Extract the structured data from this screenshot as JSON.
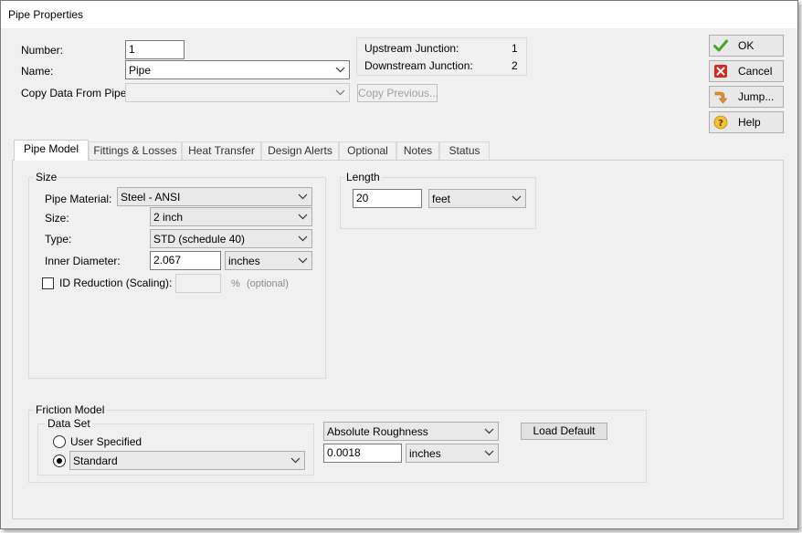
{
  "window": {
    "title": "Pipe Properties"
  },
  "header": {
    "number_label": "Number:",
    "number_value": "1",
    "name_label": "Name:",
    "name_value": "Pipe",
    "copy_label": "Copy Data From Pipe...",
    "copy_value": "",
    "copy_previous_label": "Copy Previous..."
  },
  "junctions": {
    "upstream_label": "Upstream Junction:",
    "upstream_value": "1",
    "downstream_label": "Downstream Junction:",
    "downstream_value": "2"
  },
  "side_buttons": {
    "ok": "OK",
    "cancel": "Cancel",
    "jump": "Jump...",
    "help": "Help"
  },
  "tabs": [
    {
      "label": "Pipe Model",
      "active": true
    },
    {
      "label": "Fittings & Losses",
      "active": false
    },
    {
      "label": "Heat Transfer",
      "active": false
    },
    {
      "label": "Design Alerts",
      "active": false
    },
    {
      "label": "Optional",
      "active": false
    },
    {
      "label": "Notes",
      "active": false
    },
    {
      "label": "Status",
      "active": false
    }
  ],
  "size_group": {
    "title": "Size",
    "material_label": "Pipe Material:",
    "material_value": "Steel - ANSI",
    "size_label": "Size:",
    "size_value": "2 inch",
    "type_label": "Type:",
    "type_value": "STD (schedule 40)",
    "inner_diameter_label": "Inner Diameter:",
    "inner_diameter_value": "2.067",
    "inner_diameter_unit": "inches",
    "id_reduction_label": "ID Reduction (Scaling):",
    "id_reduction_checked": false,
    "id_reduction_value": "",
    "percent_symbol": "%",
    "optional_text": "(optional)"
  },
  "length_group": {
    "title": "Length",
    "value": "20",
    "unit": "feet"
  },
  "friction_group": {
    "title": "Friction Model",
    "data_set_title": "Data Set",
    "user_specified_label": "User Specified",
    "standard_selected": true,
    "standard_value": "Standard",
    "roughness_type": "Absolute Roughness",
    "roughness_value": "0.0018",
    "roughness_unit": "inches",
    "load_default_label": "Load Default"
  },
  "colors": {
    "ok_check": "#4aa329",
    "cancel_red": "#d52b1e",
    "jump_orange": "#e8912c",
    "help_yellow": "#f2c230"
  }
}
